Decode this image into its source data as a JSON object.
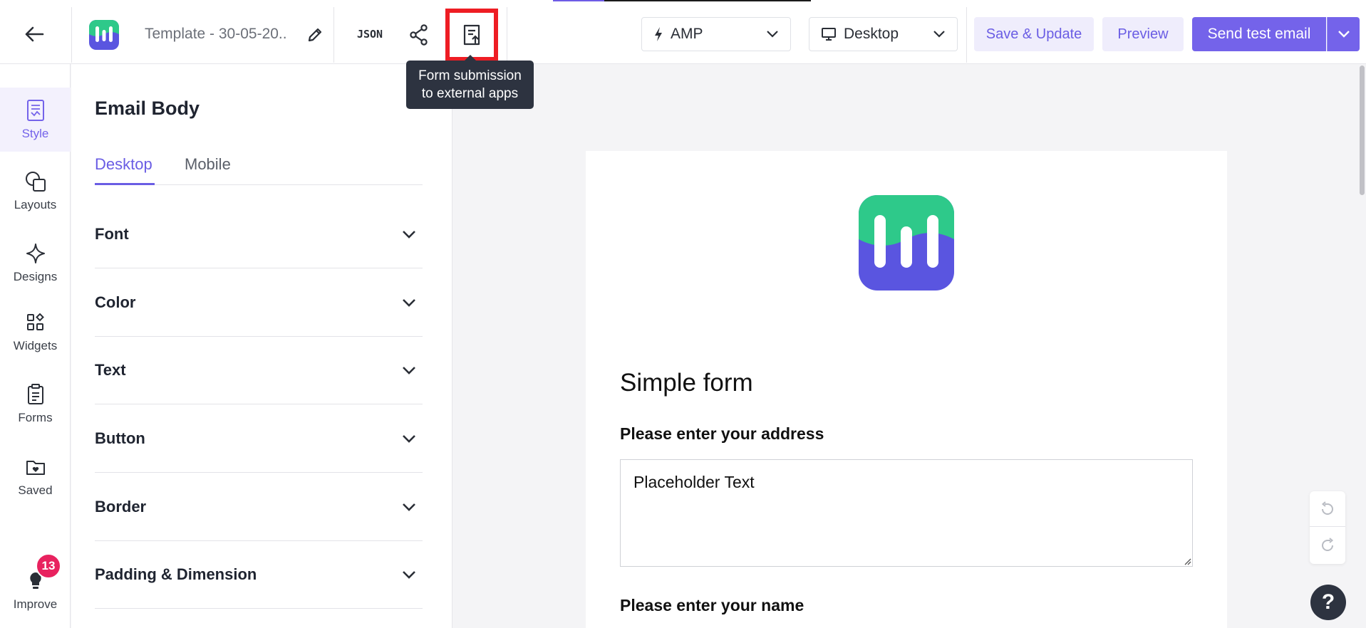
{
  "header": {
    "template_name": "Template - 30-05-20...",
    "json_label": "JSON",
    "tooltip": {
      "line1": "Form submission",
      "line2": "to external apps"
    },
    "mode_select": {
      "value": "AMP",
      "icon": "lightning-icon"
    },
    "device_select": {
      "value": "Desktop",
      "icon": "monitor-icon"
    },
    "save_label": "Save & Update",
    "preview_label": "Preview",
    "send_label": "Send test email"
  },
  "rail": {
    "items": [
      {
        "label": "Style",
        "icon": "style-icon",
        "active": true
      },
      {
        "label": "Layouts",
        "icon": "layouts-icon"
      },
      {
        "label": "Designs",
        "icon": "sparkle-icon"
      },
      {
        "label": "Widgets",
        "icon": "widgets-icon"
      },
      {
        "label": "Forms",
        "icon": "clipboard-icon"
      },
      {
        "label": "Saved",
        "icon": "folder-heart-icon"
      },
      {
        "label": "Improve",
        "icon": "bulb-icon",
        "badge": "13"
      }
    ]
  },
  "panel": {
    "title": "Email Body",
    "tabs": [
      "Desktop",
      "Mobile"
    ],
    "active_tab": "Desktop",
    "sections": [
      "Font",
      "Color",
      "Text",
      "Button",
      "Border",
      "Padding & Dimension"
    ]
  },
  "email": {
    "form_title": "Simple form",
    "question1": "Please enter your address",
    "textarea_value": "Placeholder Text",
    "question2": "Please enter your name"
  },
  "colors": {
    "accent": "#7463ea",
    "highlight_box": "#ee1d24",
    "badge": "#e8225f",
    "tooltip_bg": "#2d3340",
    "logo_green": "#2ec98a",
    "logo_purple": "#5a55e0"
  }
}
